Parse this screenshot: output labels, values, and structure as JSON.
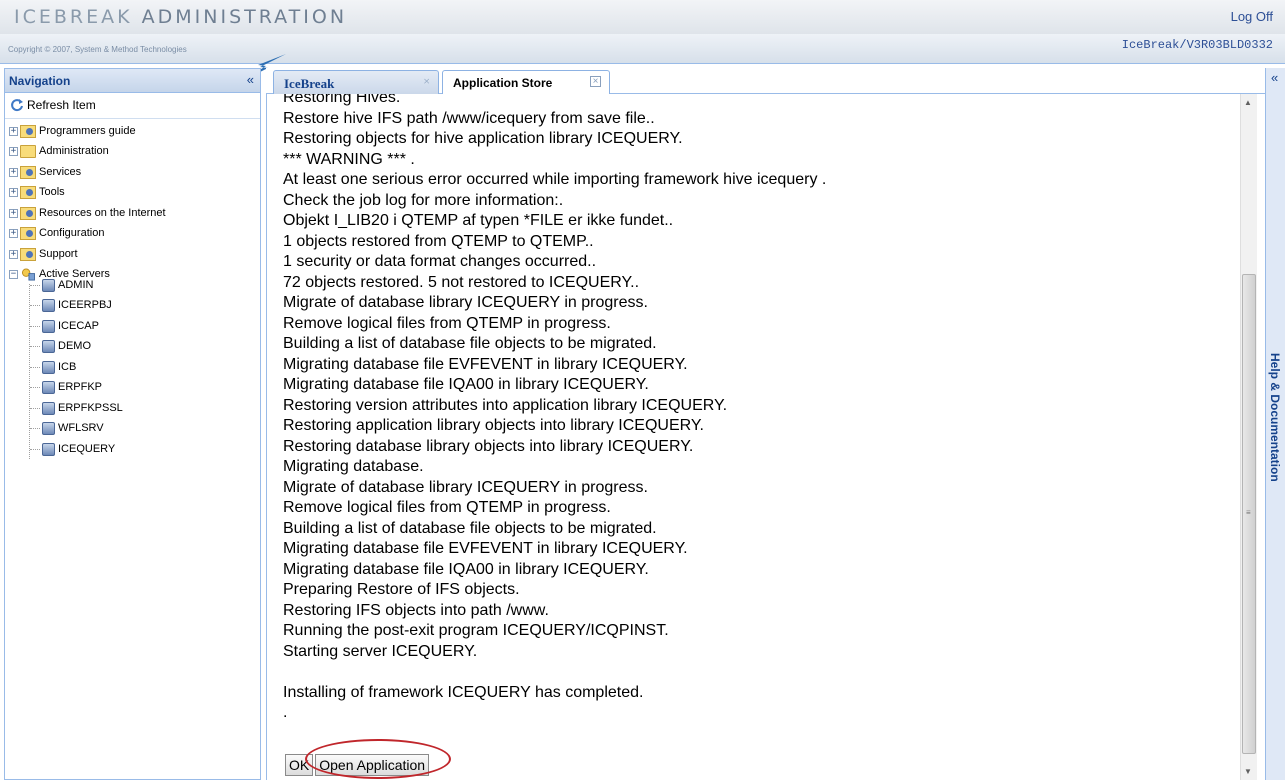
{
  "header": {
    "title_light": "ICEBREAK",
    "title_strong": "ADMINISTRATION",
    "logoff": "Log Off",
    "copyright": "Copyright © 2007, System & Method Technologies",
    "version": "IceBreak/V3R03BLD0332"
  },
  "nav": {
    "title": "Navigation",
    "collapse": "«",
    "refresh": "Refresh Item",
    "items": [
      {
        "label": "Programmers guide",
        "icon": "folder-tools-icon",
        "expander": "+"
      },
      {
        "label": "Administration",
        "icon": "folder-icon",
        "expander": "+"
      },
      {
        "label": "Services",
        "icon": "folder-services-icon",
        "expander": "+"
      },
      {
        "label": "Tools",
        "icon": "folder-tools-icon",
        "expander": "+"
      },
      {
        "label": "Resources on the Internet",
        "icon": "folder-tools-icon",
        "expander": "+"
      },
      {
        "label": "Configuration",
        "icon": "folder-services-icon",
        "expander": "+"
      },
      {
        "label": "Support",
        "icon": "folder-services-icon",
        "expander": "+"
      },
      {
        "label": "Active Servers",
        "icon": "server-status-icon",
        "expander": "−"
      }
    ],
    "servers": [
      "ADMIN",
      "ICEERPBJ",
      "ICECAP",
      "DEMO",
      "ICB",
      "ERPFKP",
      "ERPFKPSSL",
      "WFLSRV",
      "ICEQUERY"
    ]
  },
  "tabs": [
    {
      "label": "IceBreak",
      "close": "×"
    },
    {
      "label": "Application Store",
      "close": "×"
    }
  ],
  "log": {
    "lines": [
      "Restoring Hives.",
      "Restore hive IFS path /www/icequery from save file..",
      "Restoring objects for hive application library ICEQUERY.",
      "*** WARNING *** .",
      "At least one serious error occurred while importing framework hive icequery .",
      "Check the job log for more information:.",
      "Objekt I_LIB20 i QTEMP af typen *FILE er ikke fundet..",
      "1 objects restored from QTEMP to QTEMP..",
      "1 security or data format changes occurred..",
      "72 objects restored. 5 not restored to ICEQUERY..",
      "Migrate of database library ICEQUERY in progress.",
      "Remove logical files from QTEMP in progress.",
      "Building a list of database file objects to be migrated.",
      "Migrating database file EVFEVENT in library ICEQUERY.",
      "Migrating database file IQA00 in library ICEQUERY.",
      "Restoring version attributes into application library ICEQUERY.",
      "Restoring application library objects into library ICEQUERY.",
      "Restoring database library objects into library ICEQUERY.",
      "Migrating database.",
      "Migrate of database library ICEQUERY in progress.",
      "Remove logical files from QTEMP in progress.",
      "Building a list of database file objects to be migrated.",
      "Migrating database file EVFEVENT in library ICEQUERY.",
      "Migrating database file IQA00 in library ICEQUERY.",
      "Preparing Restore of IFS objects.",
      "Restoring IFS objects into path /www.",
      "Running the post-exit program ICEQUERY/ICQPINST.",
      "Starting server ICEQUERY."
    ],
    "completed": "Installing of framework ICEQUERY has completed.",
    "trailing": "."
  },
  "buttons": {
    "ok": "OK",
    "open_application": "Open Application"
  },
  "help": {
    "collapse": "«",
    "label": "Help & Documentation"
  },
  "colors": {
    "accent": "#15428b",
    "panel_border": "#99bbe8",
    "highlight_circle": "#c0262b"
  }
}
